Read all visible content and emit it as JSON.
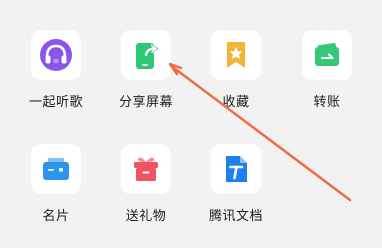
{
  "apps": [
    {
      "label": "一起听歌",
      "icon": "music-headphones-icon",
      "color": "#8b55e8"
    },
    {
      "label": "分享屏幕",
      "icon": "share-screen-icon",
      "color": "#2fc774"
    },
    {
      "label": "收藏",
      "icon": "favorites-star-icon",
      "color": "#f2b43a"
    },
    {
      "label": "转账",
      "icon": "transfer-wallet-icon",
      "color": "#37c67a"
    },
    {
      "label": "名片",
      "icon": "business-card-icon",
      "color": "#2a95ec"
    },
    {
      "label": "送礼物",
      "icon": "gift-icon",
      "color": "#f25363"
    },
    {
      "label": "腾讯文档",
      "icon": "tencent-docs-icon",
      "color": "#1e7ff0"
    }
  ],
  "annotation": {
    "icon": "annotation-arrow",
    "color": "#ef6b43"
  }
}
